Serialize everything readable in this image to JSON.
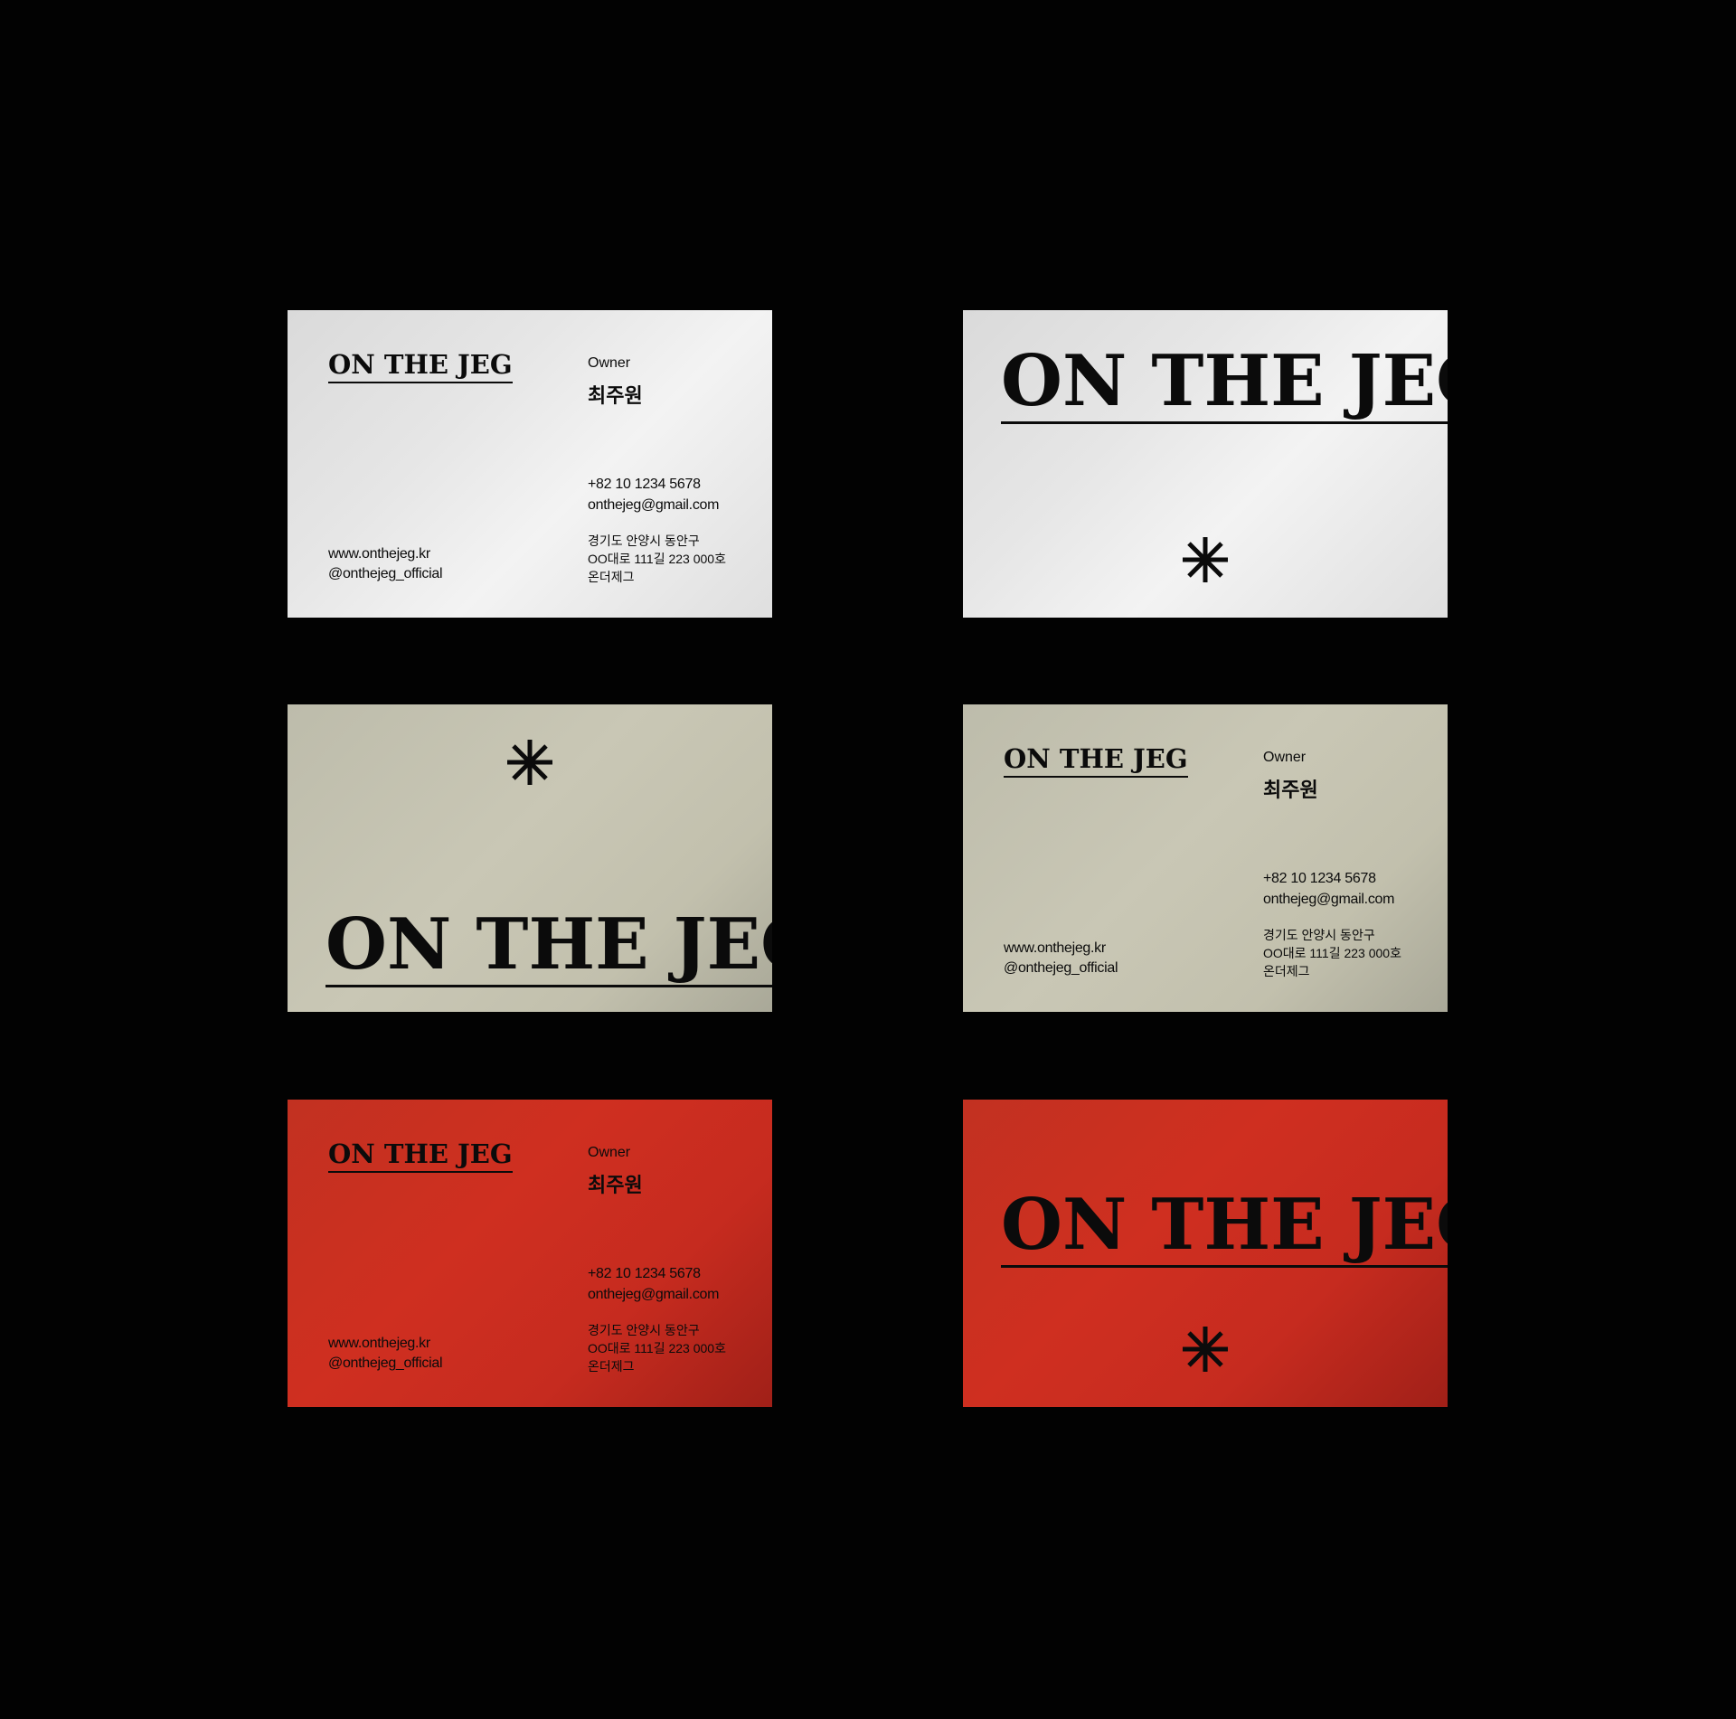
{
  "brand": "ON THE JEG",
  "contact": {
    "role": "Owner",
    "name": "최주원",
    "phone": "+82 10 1234 5678",
    "email": "onthejeg@gmail.com",
    "address1": "경기도 안양시 동안구",
    "address2": "OO대로 111길 223 000호",
    "address3": "온더제그",
    "website": "www.onthejeg.kr",
    "instagram": "@onthejeg_official"
  },
  "colors": {
    "background": "#020202",
    "silver": "#e6e6e6",
    "sage": "#c5c3b1",
    "red": "#cc2e20",
    "ink": "#0b0b0b"
  },
  "icons": [
    "asterisk-icon"
  ]
}
